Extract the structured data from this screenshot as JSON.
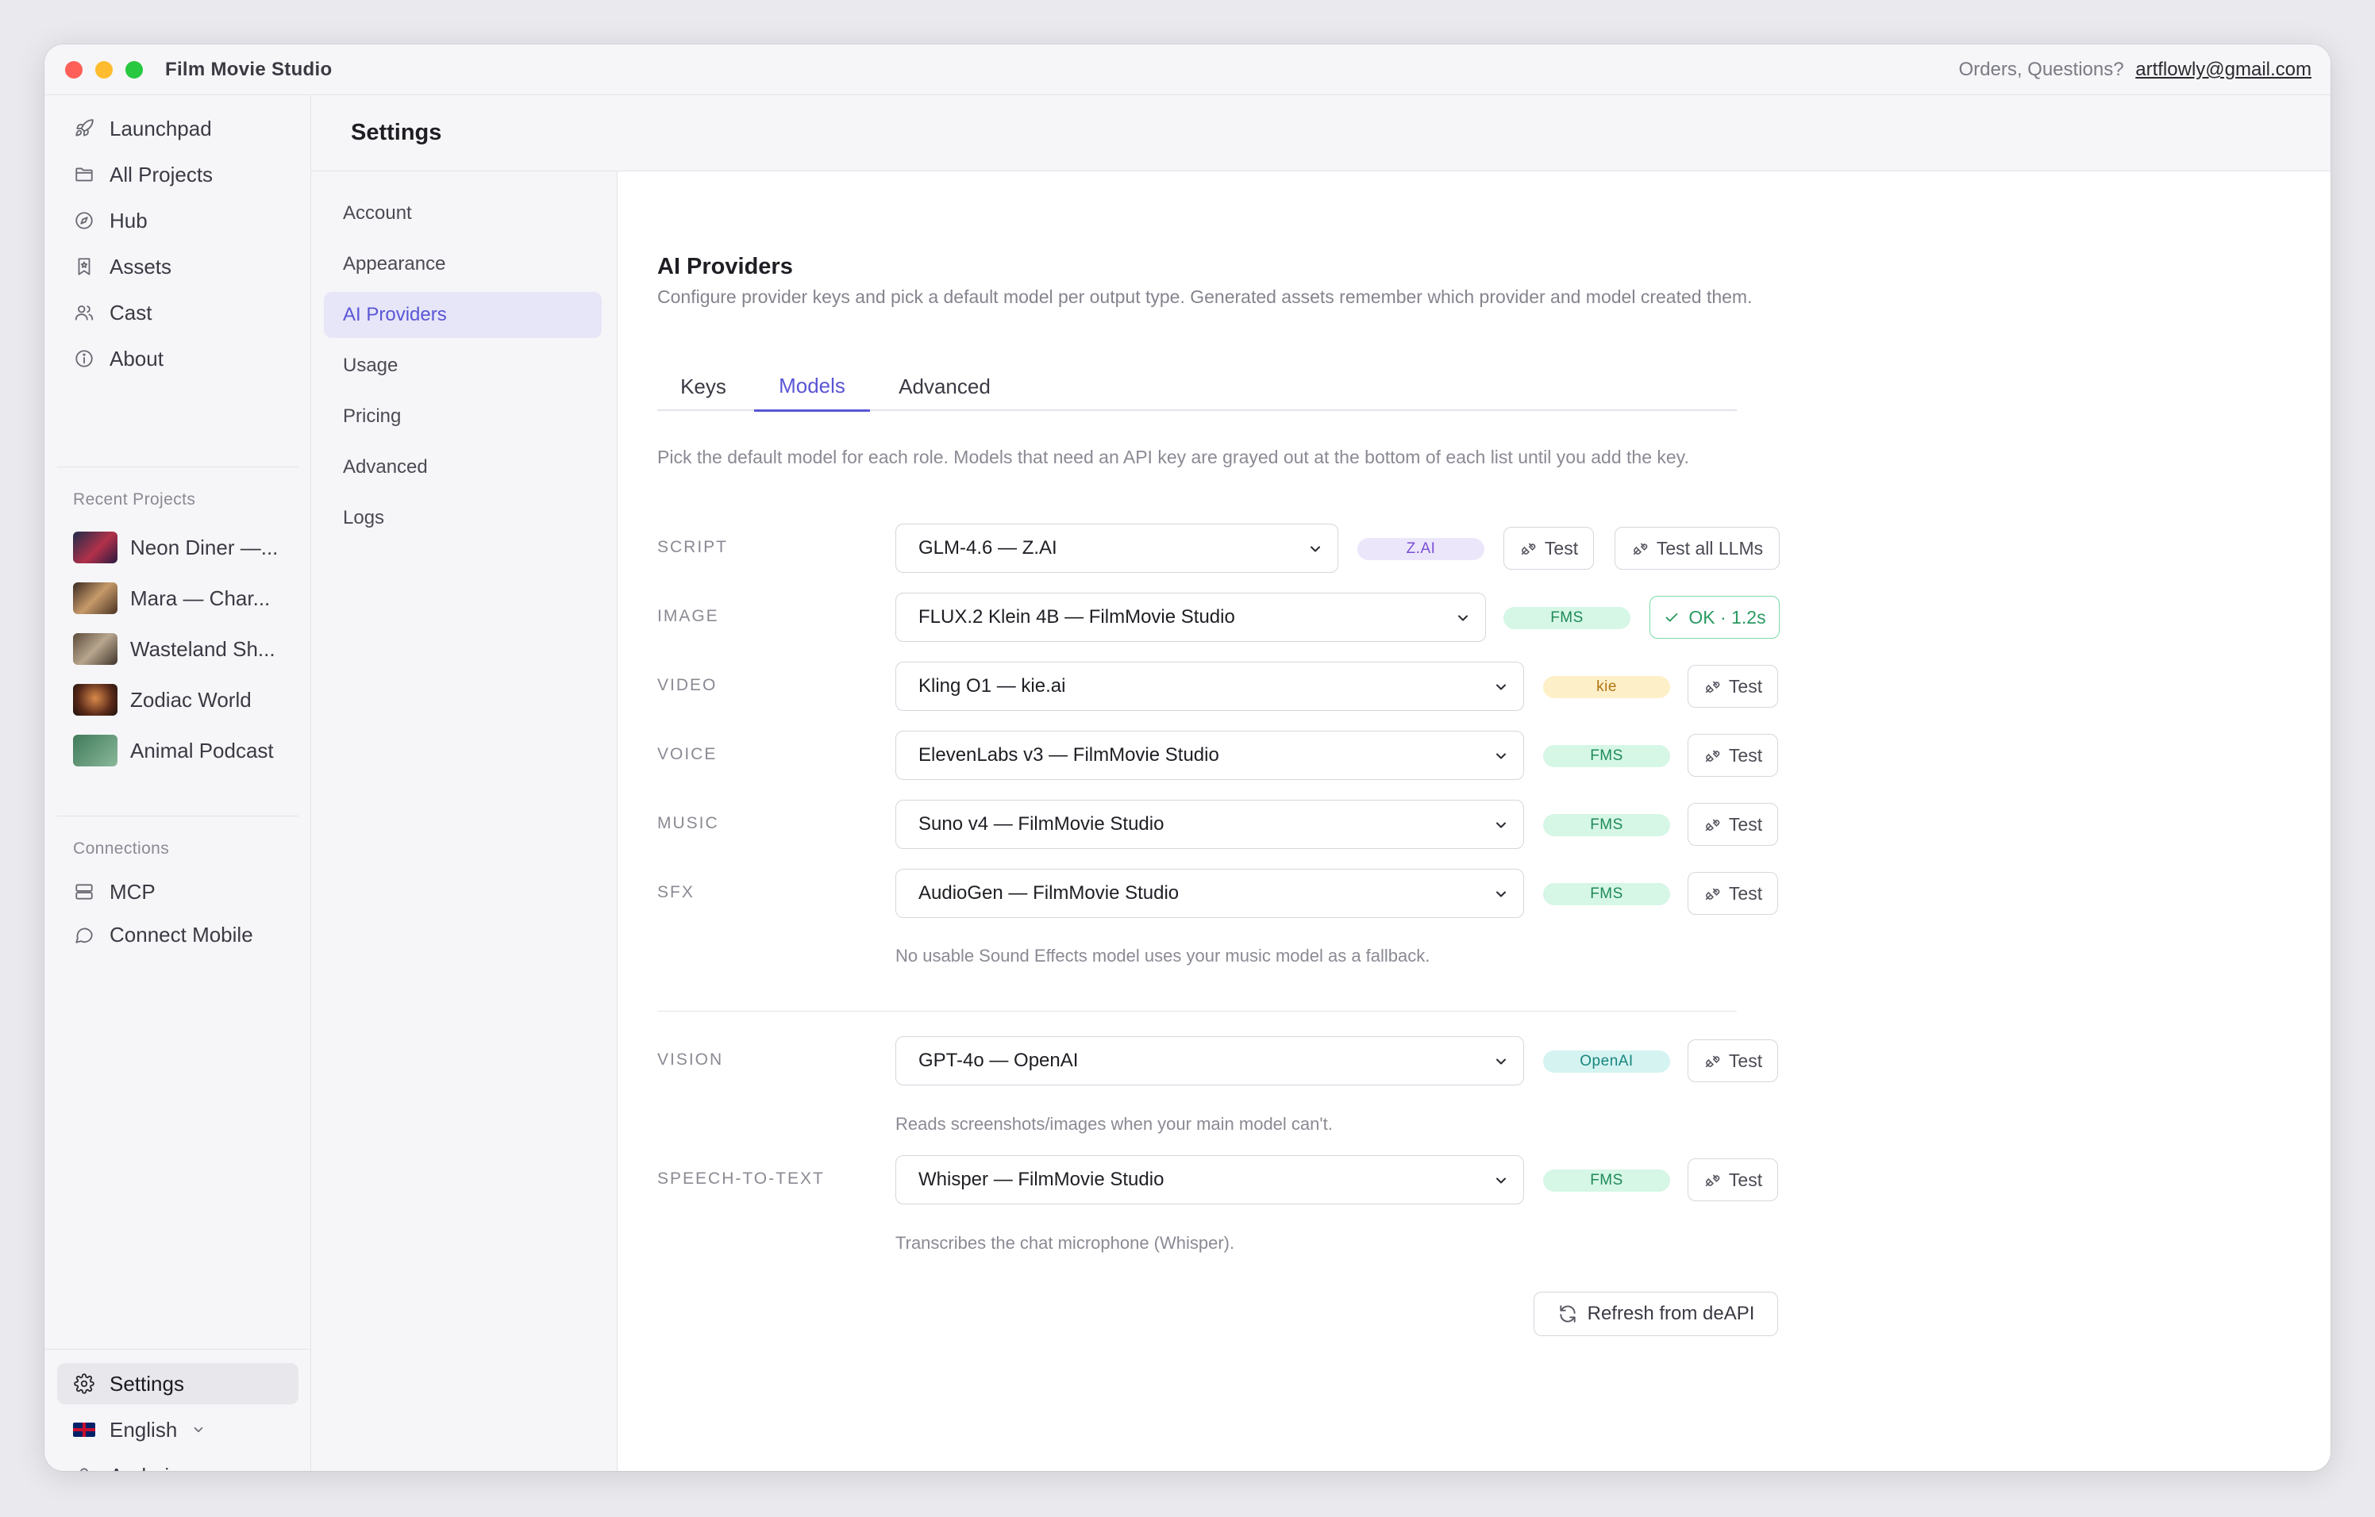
{
  "app": {
    "title": "Film Movie Studio",
    "contact_prefix": "Orders, Questions?",
    "contact_email": "artflowly@gmail.com"
  },
  "sidebar": {
    "nav": [
      {
        "label": "Launchpad",
        "icon": "rocket-icon"
      },
      {
        "label": "All Projects",
        "icon": "folder-icon"
      },
      {
        "label": "Hub",
        "icon": "compass-icon"
      },
      {
        "label": "Assets",
        "icon": "bookmark-icon"
      },
      {
        "label": "Cast",
        "icon": "users-icon"
      },
      {
        "label": "About",
        "icon": "info-icon"
      }
    ],
    "recent_heading": "Recent Projects",
    "recent": [
      {
        "label": "Neon Diner —..."
      },
      {
        "label": "Mara — Char..."
      },
      {
        "label": "Wasteland Sh..."
      },
      {
        "label": "Zodiac World"
      },
      {
        "label": "Animal Podcast"
      }
    ],
    "connections_heading": "Connections",
    "connections": [
      {
        "label": "MCP",
        "icon": "server-icon"
      },
      {
        "label": "Connect Mobile",
        "icon": "chat-bubble-icon"
      }
    ],
    "settings_label": "Settings",
    "language_label": "English",
    "user_label": "Andrej"
  },
  "settings": {
    "title": "Settings",
    "nav": [
      "Account",
      "Appearance",
      "AI Providers",
      "Usage",
      "Pricing",
      "Advanced",
      "Logs"
    ],
    "active_nav": "AI Providers"
  },
  "main": {
    "title": "AI Providers",
    "description": "Configure provider keys and pick a default model per output type. Generated assets remember which provider and model created them.",
    "tabs": [
      "Keys",
      "Models",
      "Advanced"
    ],
    "active_tab": "Models",
    "intro": "Pick the default model for each role. Models that need an API key are grayed out at the bottom of each list until you add the key.",
    "roles": [
      {
        "label": "SCRIPT",
        "model": "GLM-4.6 — Z.AI",
        "badge": "Z.AI",
        "button": "Test",
        "extra_button": "Test all LLMs"
      },
      {
        "label": "IMAGE",
        "model": "FLUX.2 Klein 4B — FilmMovie Studio",
        "badge": "FMS",
        "status": "OK · 1.2s"
      },
      {
        "label": "VIDEO",
        "model": "Kling O1 — kie.ai",
        "badge": "kie",
        "button": "Test"
      },
      {
        "label": "VOICE",
        "model": "ElevenLabs v3 — FilmMovie Studio",
        "badge": "FMS",
        "button": "Test"
      },
      {
        "label": "MUSIC",
        "model": "Suno v4 — FilmMovie Studio",
        "badge": "FMS",
        "button": "Test"
      },
      {
        "label": "SFX",
        "model": "AudioGen — FilmMovie Studio",
        "badge": "FMS",
        "button": "Test"
      }
    ],
    "sfx_note": "No usable Sound Effects model uses your music model as a fallback.",
    "vision": {
      "label": "VISION",
      "model": "GPT-4o — OpenAI",
      "badge": "OpenAI",
      "button": "Test",
      "note": "Reads screenshots/images when your main model can't."
    },
    "stt": {
      "label": "SPEECH-TO-TEXT",
      "model": "Whisper — FilmMovie Studio",
      "badge": "FMS",
      "button": "Test",
      "note": "Transcribes the chat microphone (Whisper)."
    },
    "refresh_label": "Refresh from deAPI"
  },
  "colors": {
    "accent": "#5a55d6",
    "ok": "#2a9a62"
  }
}
